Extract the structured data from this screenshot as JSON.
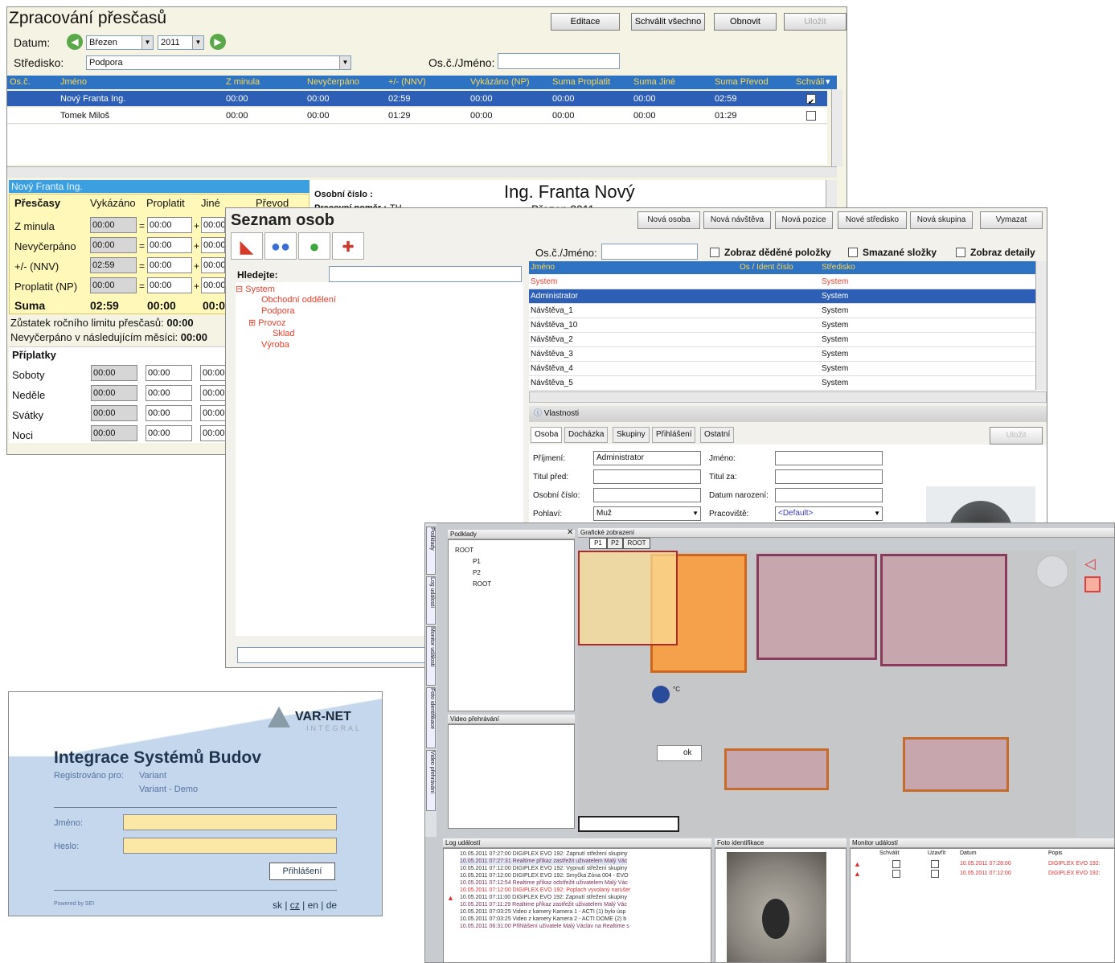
{
  "overtime": {
    "title": "Zpracování přesčasů",
    "buttons": {
      "edit": "Editace",
      "approve_all": "Schválit všechno",
      "refresh": "Obnovit",
      "save": "Uložit"
    },
    "date_label": "Datum:",
    "month": "Březen",
    "year": "2011",
    "center_label": "Středisko:",
    "center_value": "Podpora",
    "search_label": "Os.č./Jméno:",
    "columns": [
      "Os.č.",
      "Jméno",
      "Z minula",
      "Nevyčerpáno",
      "+/- (NNV)",
      "Vykázáno (NP)",
      "Suma Proplatit",
      "Suma Jiné",
      "Suma Převod",
      "Schváli"
    ],
    "rows": [
      {
        "name": "Nový Franta Ing.",
        "cells": [
          "00:00",
          "00:00",
          "02:59",
          "00:00",
          "00:00",
          "00:00",
          "02:59"
        ],
        "checked": "✔"
      },
      {
        "name": "Tomek Miloš",
        "cells": [
          "00:00",
          "00:00",
          "01:29",
          "00:00",
          "00:00",
          "00:00",
          "01:29"
        ],
        "checked": ""
      }
    ],
    "detail": {
      "header": "Nový Franta Ing.",
      "col_prescasy": "Přesčasy",
      "col_vykazano": "Vykázáno",
      "col_proplatit": "Proplatit",
      "col_jine": "Jiné",
      "col_prevod": "Převod",
      "rows": [
        {
          "label": "Z minula",
          "v": "00:00",
          "p": "00:00",
          "j": "00:00"
        },
        {
          "label": "Nevyčerpáno",
          "v": "00:00",
          "p": "00:00",
          "j": "00:00"
        },
        {
          "label": "+/- (NNV)",
          "v": "02:59",
          "p": "00:00",
          "j": "00:00"
        },
        {
          "label": "Proplatit (NP)",
          "v": "00:00",
          "p": "00:00",
          "j": "00:00"
        }
      ],
      "sum_label": "Suma",
      "sum_v": "02:59",
      "sum_p": "00:00",
      "sum_j": "00:00",
      "remaining_label": "Zůstatek ročního limitu přesčasů:",
      "remaining_value": "00:00",
      "unused_label": "Nevyčerpáno v následujícím měsíci:",
      "unused_value": "00:00",
      "bonuses_label": "Příplatky",
      "bonuses": [
        {
          "label": "Soboty",
          "a": "00:00",
          "b": "00:00",
          "c": "00:00"
        },
        {
          "label": "Neděle",
          "a": "00:00",
          "b": "00:00",
          "c": "00:00"
        },
        {
          "label": "Svátky",
          "a": "00:00",
          "b": "00:00",
          "c": "00:00"
        },
        {
          "label": "Noci",
          "a": "00:00",
          "b": "00:00",
          "c": "00:00"
        }
      ],
      "personal_number_label": "Osobní číslo :",
      "employment_label": "Pracovní poměr :",
      "employment_value": "TH",
      "person_name": "Ing. Franta Nový",
      "period": "Březen 2011"
    }
  },
  "persons": {
    "title": "Seznam osob",
    "buttons": [
      "Nová osoba",
      "Nová návštěva",
      "Nová pozice",
      "Nové středisko",
      "Nová skupina",
      "Vymazat"
    ],
    "search_label": "Hledejte:",
    "tree": {
      "root": "System",
      "items": [
        "Obchodní oddělení",
        "Podpora"
      ],
      "provoz": "Provoz",
      "sklad": "Sklad",
      "vyroba": "Výroba"
    },
    "filter_label": "Os.č./Jméno:",
    "filters": [
      "Zobraz děděné položky",
      "Smazané složky",
      "Zobraz detaily"
    ],
    "columns": [
      "Jméno",
      "Os / Ident číslo",
      "Středisko"
    ],
    "rows": [
      {
        "name": "System",
        "center": "System",
        "red": true
      },
      {
        "name": "Administrator",
        "center": "System",
        "selected": true
      },
      {
        "name": "Návštěva_1",
        "center": "System"
      },
      {
        "name": "Návštěva_10",
        "center": "System"
      },
      {
        "name": "Návštěva_2",
        "center": "System"
      },
      {
        "name": "Návštěva_3",
        "center": "System"
      },
      {
        "name": "Návštěva_4",
        "center": "System"
      },
      {
        "name": "Návštěva_5",
        "center": "System"
      }
    ],
    "props_title": "Vlastnosti",
    "tabs": [
      "Osoba",
      "Docházka",
      "Skupiny",
      "Přihlášení",
      "Ostatní"
    ],
    "save": "Uložit",
    "fields": {
      "surname_label": "Příjmení:",
      "surname": "Administrator",
      "title_before_label": "Titul před:",
      "personal_no_label": "Osobní číslo:",
      "gender_label": "Pohlaví:",
      "gender": "Muž",
      "name_label": "Jméno:",
      "title_after_label": "Titul za:",
      "birth_label": "Datum narození:",
      "workplace_label": "Pracoviště:",
      "workplace": "<Default>"
    }
  },
  "login": {
    "brand": "VAR-NET",
    "brand_sub": "INTEGRAL",
    "title": "Integrace Systémů Budov",
    "reg_label": "Registrováno pro:",
    "reg_line1": "Variant",
    "reg_line2": "Variant - Demo",
    "user_label": "Jméno:",
    "pass_label": "Heslo:",
    "login_button": "Přihlášení",
    "powered": "Powered by SEI",
    "lang_sk": "sk",
    "lang_cz": "cz",
    "lang_en": "en",
    "lang_de": "de"
  },
  "monitor": {
    "side_tabs": [
      "Podklady",
      "Log událostí",
      "Monitor událostí",
      "Foto identifikace",
      "Video přehrávání"
    ],
    "layers_title": "Podklady",
    "layers": [
      "ROOT",
      "P1",
      "P2",
      "ROOT"
    ],
    "graphic_title": "Grafické zobrazení",
    "graphic_tabs": [
      "P1",
      "P2",
      "ROOT"
    ],
    "video_title": "Video přehrávání",
    "temp_unit": "°C",
    "ok": "ok",
    "log_title": "Log událostí",
    "log": [
      {
        "t": "10.05.2011 07:27:00",
        "m": "DIGIPLEX EVO 192: Zapnutí střežení skupiny",
        "c": "#333"
      },
      {
        "t": "10.05.2011 07:27:31",
        "m": "Realtime příkaz zastřežit uživatelem Malý Vác",
        "c": "#7a2f5a"
      },
      {
        "t": "10.05.2011 07:12:00",
        "m": "DIGIPLEX EVO 192: Vypnutí střežení skupiny",
        "c": "#333"
      },
      {
        "t": "10.05.2011 07:12:00",
        "m": "DIGIPLEX EVO 192: Smyčka Zóna 004 - EVO",
        "c": "#333"
      },
      {
        "t": "10.05.2011 07:12:54",
        "m": "Realtime příkaz odstřežit uživatelem Malý Vác",
        "c": "#7a2f5a"
      },
      {
        "t": "10.05.2011 07:12:00",
        "m": "DIGIPLEX EVO 192: Poplach vyvolaný narušer",
        "c": "#e03030"
      },
      {
        "t": "10.05.2011 07:11:00",
        "m": "DIGIPLEX EVO 192: Zapnutí střežení skupiny",
        "c": "#333"
      },
      {
        "t": "10.05.2011 07:11:29",
        "m": "Realtime příkaz zastřežit uživatelem Malý Vác",
        "c": "#7a2f5a"
      },
      {
        "t": "10.05.2011 07:03:25",
        "m": "Video z kamery Kamera 1 - ACTI (1) bylo úsp",
        "c": "#333"
      },
      {
        "t": "10.05.2011 07:03:25",
        "m": "Video z kamery Kamera 2 - ACTI DOME (2) b",
        "c": "#333"
      },
      {
        "t": "10.05.2011 06:31:00",
        "m": "Přihlášení uživatele Malý Václav na Realtime s",
        "c": "#7a2f5a"
      }
    ],
    "photo_title": "Foto identifikace",
    "events_title": "Monitor událostí",
    "events_cols": [
      "Schválit",
      "Uzavřít",
      "Datum",
      "Popis"
    ],
    "events": [
      {
        "date": "10.05.2011 07:28:00",
        "desc": "DIGIPLEX EVO 192:"
      },
      {
        "date": "10.05.2011 07:12:00",
        "desc": "DIGIPLEX EVO 192:"
      }
    ]
  },
  "colors": {
    "header_blue": "#2e72c4",
    "select_blue": "#2e5fb6",
    "orange": "#f5a04a",
    "tree_red": "#e8402c"
  }
}
